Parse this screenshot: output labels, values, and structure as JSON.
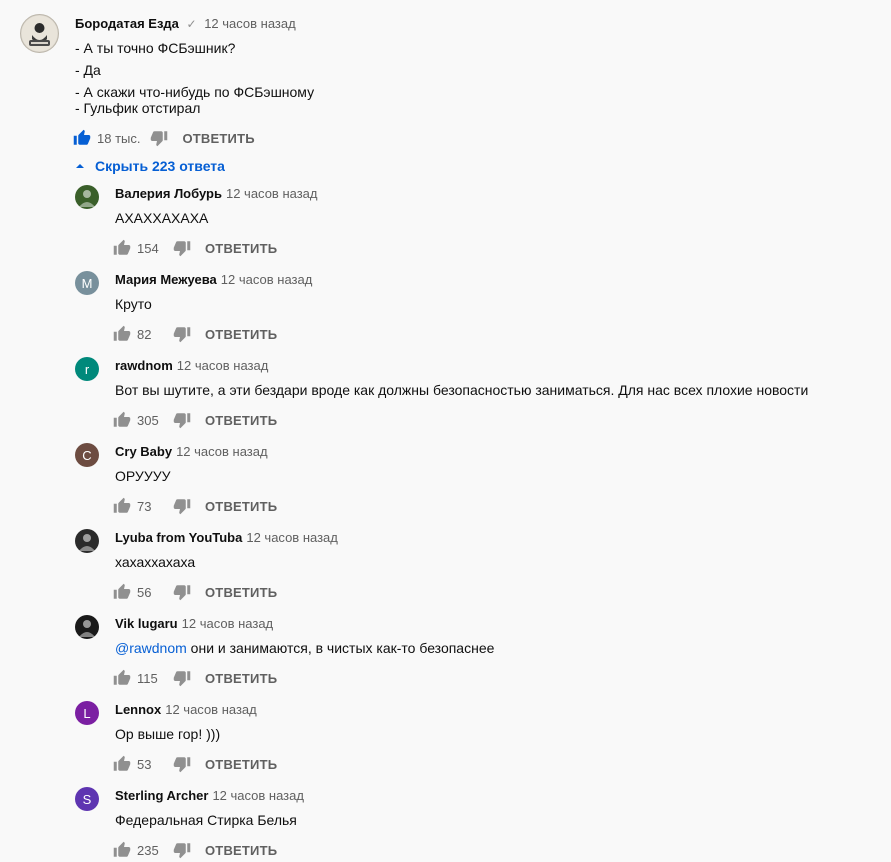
{
  "main_comment": {
    "author": "Бородатая Езда",
    "time": "12 часов назад",
    "lines": [
      "- А ты точно ФСБэшник?",
      "- Да",
      "- А скажи что-нибудь по ФСБэшному",
      "- Гульфик отстирал"
    ],
    "likes": "18 тыс.",
    "reply_label": "ОТВЕТИТЬ",
    "like_color": "#065fd4",
    "avatar_icon": "bearded-rider-logo"
  },
  "replies_toggle": "Скрыть 223 ответа",
  "replies": [
    {
      "author": "Валерия Лобурь",
      "time": "12 часов назад",
      "text": "АХАХХАХАХА",
      "likes": "154",
      "reply_label": "ОТВЕТИТЬ",
      "avatar_letter": "",
      "avatar_color": "#3a5f2a"
    },
    {
      "author": "Мария Межуева",
      "time": "12 часов назад",
      "text": "Круто",
      "likes": "82",
      "reply_label": "ОТВЕТИТЬ",
      "avatar_letter": "М",
      "avatar_color": "#78909c"
    },
    {
      "author": "rawdnom",
      "time": "12 часов назад",
      "text": "Вот вы шутите, а эти бездари вроде как должны безопасностью заниматься. Для нас всех плохие новости",
      "likes": "305",
      "reply_label": "ОТВЕТИТЬ",
      "avatar_letter": "r",
      "avatar_color": "#00897b"
    },
    {
      "author": "Cry Baby",
      "time": "12 часов назад",
      "text": "ОРУУУУ",
      "likes": "73",
      "reply_label": "ОТВЕТИТЬ",
      "avatar_letter": "C",
      "avatar_color": "#6d4c41"
    },
    {
      "author": "Lyuba from YouTuba",
      "time": "12 часов назад",
      "text": "хахаххахаха",
      "likes": "56",
      "reply_label": "ОТВЕТИТЬ",
      "avatar_letter": "",
      "avatar_color": "#2b2b2b"
    },
    {
      "author": "Vik lugaru",
      "time": "12 часов назад",
      "mention": "@rawdnom",
      "text": " они и занимаются, в чистых как-то безопаснее",
      "likes": "115",
      "reply_label": "ОТВЕТИТЬ",
      "avatar_letter": "",
      "avatar_color": "#1a1a1a"
    },
    {
      "author": "Lennox",
      "time": "12 часов назад",
      "text": "Ор выше гор! )))",
      "likes": "53",
      "reply_label": "ОТВЕТИТЬ",
      "avatar_letter": "L",
      "avatar_color": "#7b1fa2"
    },
    {
      "author": "Sterling Archer",
      "time": "12 часов назад",
      "text": "Федеральная Стирка Белья",
      "likes": "235",
      "reply_label": "ОТВЕТИТЬ",
      "avatar_letter": "S",
      "avatar_color": "#5e35b1"
    }
  ]
}
